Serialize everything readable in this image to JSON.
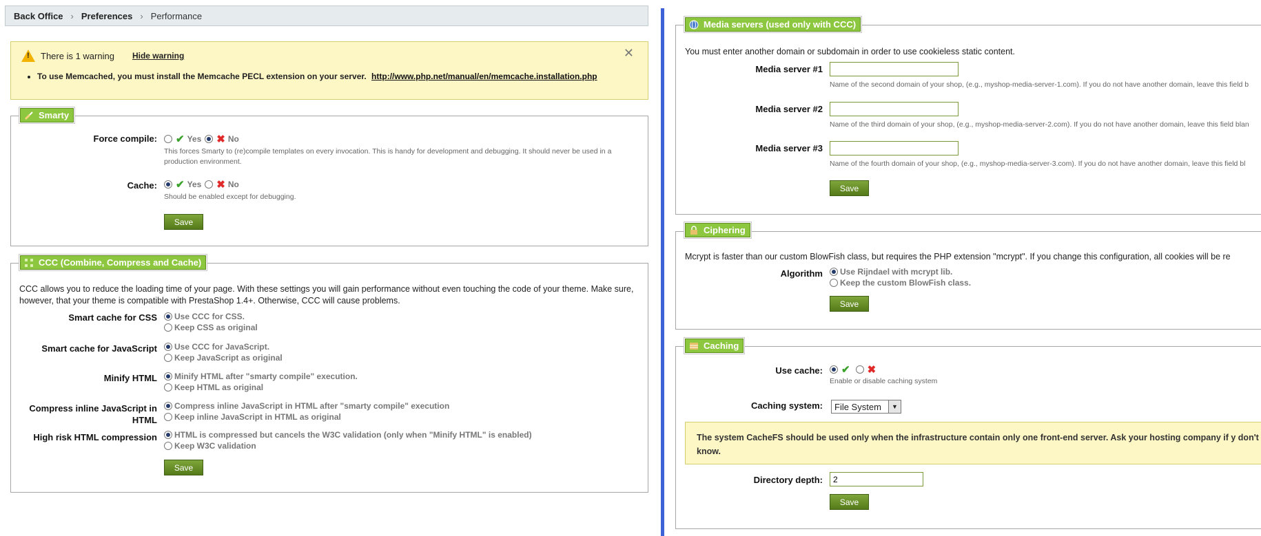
{
  "breadcrumb": [
    "Back Office",
    "Preferences",
    "Performance"
  ],
  "warning": {
    "title": "There is 1 warning",
    "hide_label": "Hide warning",
    "message": "To use Memcached, you must install the Memcache PECL extension on your server.",
    "link": "http://www.php.net/manual/en/memcache.installation.php"
  },
  "smarty": {
    "legend": "Smarty",
    "force_compile": {
      "label": "Force compile:",
      "yes": "Yes",
      "no": "No",
      "value": "no",
      "hint": "This forces Smarty to (re)compile templates on every invocation. This is handy for development and debugging. It should never be used in a production environment."
    },
    "cache": {
      "label": "Cache:",
      "yes": "Yes",
      "no": "No",
      "value": "yes",
      "hint": "Should be enabled except for debugging."
    },
    "save": "Save"
  },
  "ccc": {
    "legend": "CCC (Combine, Compress and Cache)",
    "description": "CCC allows you to reduce the loading time of your page. With these settings you will gain performance without even touching the code of your theme. Make sure, however, that your theme is compatible with PrestaShop 1.4+. Otherwise, CCC will cause problems.",
    "rows": [
      {
        "label": "Smart cache for CSS",
        "options": [
          "Use CCC for CSS.",
          "Keep CSS as original"
        ],
        "selected": 0
      },
      {
        "label": "Smart cache for JavaScript",
        "options": [
          "Use CCC for JavaScript.",
          "Keep JavaScript as original"
        ],
        "selected": 0
      },
      {
        "label": "Minify HTML",
        "options": [
          "Minify HTML after \"smarty compile\" execution.",
          "Keep HTML as original"
        ],
        "selected": 0
      },
      {
        "label": "Compress inline JavaScript in HTML",
        "options": [
          "Compress inline JavaScript in HTML after \"smarty compile\" execution",
          "Keep inline JavaScript in HTML as original"
        ],
        "selected": 0
      },
      {
        "label": "High risk HTML compression",
        "options": [
          "HTML is compressed but cancels the W3C validation (only when \"Minify HTML\" is enabled)",
          "Keep W3C validation"
        ],
        "selected": 0
      }
    ],
    "save": "Save"
  },
  "media": {
    "legend": "Media servers (used only with CCC)",
    "intro": "You must enter another domain or subdomain in order to use cookieless static content.",
    "servers": [
      {
        "label": "Media server #1",
        "value": "",
        "hint": "Name of the second domain of your shop, (e.g., myshop-media-server-1.com). If you do not have another domain, leave this field b"
      },
      {
        "label": "Media server #2",
        "value": "",
        "hint": "Name of the third domain of your shop, (e.g., myshop-media-server-2.com). If you do not have another domain, leave this field blan"
      },
      {
        "label": "Media server #3",
        "value": "",
        "hint": "Name of the fourth domain of your shop, (e.g., myshop-media-server-3.com). If you do not have another domain, leave this field bl"
      }
    ],
    "save": "Save"
  },
  "ciphering": {
    "legend": "Ciphering",
    "intro": "Mcrypt is faster than our custom BlowFish class, but requires the PHP extension \"mcrypt\". If you change this configuration, all cookies will be re",
    "label": "Algorithm",
    "options": [
      "Use Rijndael with mcrypt lib.",
      "Keep the custom BlowFish class."
    ],
    "selected": 0,
    "save": "Save"
  },
  "caching": {
    "legend": "Caching",
    "use_cache_label": "Use cache:",
    "use_cache_value": "yes",
    "use_cache_hint": "Enable or disable caching system",
    "system_label": "Caching system:",
    "system_value": "File System",
    "notice": "The system CacheFS should be used only when the infrastructure contain only one front-end server. Ask your hosting company if y don't know.",
    "depth_label": "Directory depth:",
    "depth_value": "2",
    "save": "Save"
  },
  "colors": {
    "accent_green": "#8dc63f",
    "button_green": "#557a1a",
    "warning_bg": "#fdf7c5",
    "divider_blue": "#3d62d8"
  }
}
